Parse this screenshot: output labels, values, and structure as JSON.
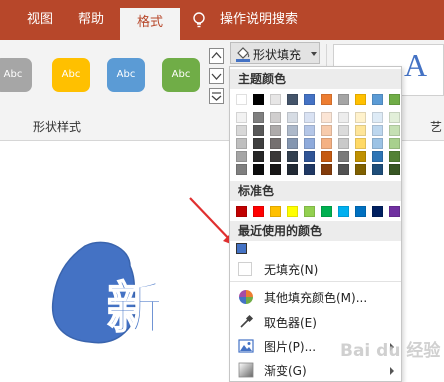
{
  "tabs": {
    "view": "视图",
    "help": "帮助",
    "format": "格式",
    "tell_me": "操作说明搜索"
  },
  "shape_styles": {
    "group_label": "形状样式",
    "swatches": [
      {
        "label": "Abc",
        "color": "#a6a6a6"
      },
      {
        "label": "Abc",
        "color": "#ffc000"
      },
      {
        "label": "Abc",
        "color": "#5b9bd5"
      },
      {
        "label": "Abc",
        "color": "#70ad47"
      }
    ]
  },
  "ribbon_right": {
    "letter": "A",
    "group_label_partial": "艺"
  },
  "fill_menu": {
    "button_label": "形状填充",
    "theme_colors_title": "主题颜色",
    "theme_top": [
      "#ffffff",
      "#000000",
      "#e7e6e6",
      "#44546a",
      "#4472c4",
      "#ed7d31",
      "#a5a5a5",
      "#ffc000",
      "#5b9bd5",
      "#70ad47"
    ],
    "theme_shades": [
      [
        "#f2f2f2",
        "#7f7f7f",
        "#d0cece",
        "#d6dce4",
        "#d9e2f3",
        "#fbe5d5",
        "#ededed",
        "#fff2cc",
        "#deebf6",
        "#e2efd9"
      ],
      [
        "#d8d8d8",
        "#595959",
        "#aeabab",
        "#adb9ca",
        "#b4c6e7",
        "#f7cbac",
        "#dbdbdb",
        "#fee599",
        "#bdd7ee",
        "#c5e0b3"
      ],
      [
        "#bfbfbf",
        "#3f3f3f",
        "#757070",
        "#8496b0",
        "#8eaadb",
        "#f4b183",
        "#c9c9c9",
        "#ffd965",
        "#9cc3e5",
        "#a8d08d"
      ],
      [
        "#a5a5a5",
        "#262626",
        "#3a3838",
        "#323f4f",
        "#2f5496",
        "#c55a11",
        "#7b7b7b",
        "#bf9000",
        "#2e75b5",
        "#538135"
      ],
      [
        "#7f7f7f",
        "#0c0c0c",
        "#171616",
        "#222a35",
        "#1f3864",
        "#833c0b",
        "#525252",
        "#7f6000",
        "#1e4e79",
        "#375623"
      ]
    ],
    "standard_colors_title": "标准色",
    "standard_colors": [
      "#c00000",
      "#ff0000",
      "#ffc000",
      "#ffff00",
      "#92d050",
      "#00b050",
      "#00b0f0",
      "#0070c0",
      "#002060",
      "#7030a0"
    ],
    "recent_colors_title": "最近使用的颜色",
    "recent_colors": [
      "#4472c4"
    ],
    "items": [
      {
        "label": "无填充(N)",
        "icon": "no-fill-icon"
      },
      {
        "label": "其他填充颜色(M)...",
        "icon": "color-wheel-icon"
      },
      {
        "label": "取色器(E)",
        "icon": "eyedropper-icon"
      },
      {
        "label": "图片(P)...",
        "icon": "picture-icon"
      },
      {
        "label": "渐变(G)",
        "icon": "gradient-icon"
      }
    ]
  },
  "canvas": {
    "shape_color": "#4472c4",
    "shape_char": "新"
  },
  "annotation": {
    "arrow_color": "#e03030"
  },
  "watermark": "Bai du 经验"
}
